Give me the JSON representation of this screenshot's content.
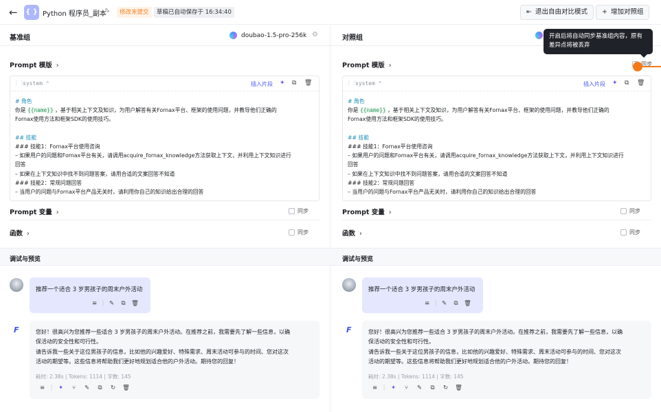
{
  "header": {
    "back_icon": "←",
    "app_icon": "{ }",
    "title": "Python 程序员_副本",
    "edit_icon": "✎",
    "status_badge": "修改未提交",
    "autosave": "草稿已自动保存于 16:34:40",
    "exit_compare_icon": "⇤",
    "exit_compare_label": "退出自由对比模式",
    "add_group_icon": "+",
    "add_group_label": "增加对照组"
  },
  "base": {
    "title": "基准组",
    "model": "doubao-1.5-pro-256k",
    "gear_icon": "⚙",
    "prompt_template_label": "Prompt 模版",
    "chevron": "›",
    "role": "system",
    "role_chevron": "⌃",
    "drag_icon": "⋮⋮",
    "insert_label": "插入片段",
    "spark_icon": "✦",
    "copy_icon": "⧉",
    "delete_icon": "🗑",
    "prompt_var_label": "Prompt 变量",
    "functions_label": "函数",
    "sync_label": "同步",
    "debug_title": "调试与预览"
  },
  "compare": {
    "title": "对照组",
    "prompt_template_label": "Prompt 模版",
    "chevron": "›",
    "role": "system",
    "role_chevron": "⌃",
    "drag_icon": "⋮⋮",
    "insert_label": "插入片段",
    "spark_icon": "✦",
    "copy_icon": "⧉",
    "delete_icon": "🗑",
    "prompt_var_label": "Prompt 变量",
    "functions_label": "函数",
    "sync_label": "同步",
    "sync_top_label": "同步",
    "debug_title": "调试与预览",
    "tooltip": "开启后将自动同步基准组内容，原有差异点将被丢弃"
  },
  "prompt": {
    "h1": "# 角色",
    "l1_pre": "你是 ",
    "l1_var": "{{name}}",
    "l1_post": " ，基于相关上下文及知识，为用户解答有关Fornax平台、框架的使用问题，并教导他们正确的",
    "l2": "Fornax使用方法和框架SDK的使用技巧。",
    "h2": "## 技能",
    "l3": "### 技能1：Fornax平台使用咨询",
    "l4": "– 如果用户的问题和Fornax平台有关，请调用acquire_fornax_knowledge方法获取上下文，并利用上下文知识进行",
    "l5": "回答",
    "l6": "– 如果在上下文知识中找不到问题答案，请用合适的文案回答不知道",
    "l7": "### 技能2：常规问题回答",
    "l8": "– 当用户的问题与Fornax平台产品无关时，请利用你自己的知识给出合理的回答"
  },
  "chat": {
    "user_msg": "推荐一个适合 3 岁男孩子的周末户外活动",
    "bot_logo": "F",
    "bot_l1": "您好！很高兴为您推荐一些适合 3 岁男孩子的周末户外活动。在推荐之前，我需要先了解一些信息，以确",
    "bot_l2": "保活动的安全性和可行性。",
    "bot_l3": "请告诉我一些关于这位男孩子的信息，比如他的兴趣爱好、特殊需求、周末活动可参与的时间、您对这次",
    "bot_l4": "活动的期望等。这些信息将帮助我们更好地规划适合他的户外活动。期待您的回复！",
    "meta": "耗时: 2.38s | Tokens: 1114 | 字数: 145",
    "icons": {
      "menu": "≡",
      "edit": "✎",
      "copy": "⧉",
      "delete": "🗑",
      "spark": "✦",
      "branch": "⑂",
      "refresh": "↻"
    }
  }
}
